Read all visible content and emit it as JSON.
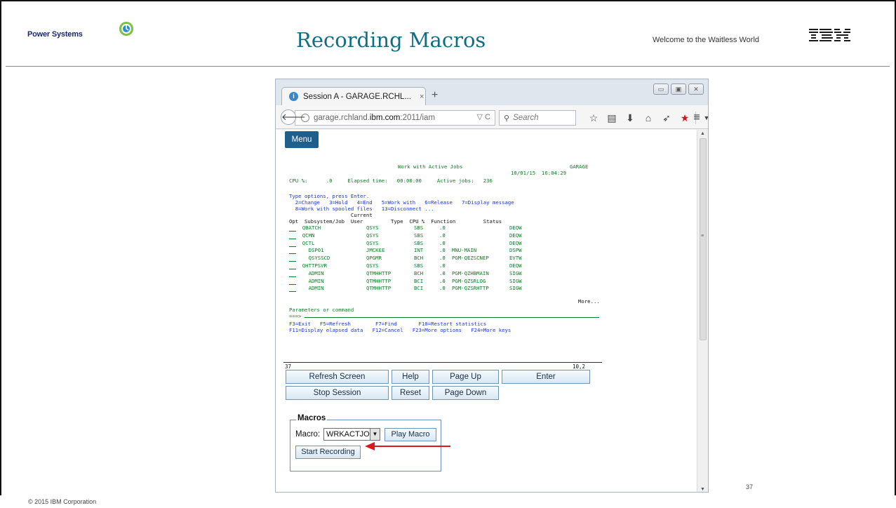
{
  "slide": {
    "title": "Recording Macros",
    "brand_left": "Power Systems",
    "welcome": "Welcome to the Waitless World",
    "brand_right": "IBM",
    "copyright": "© 2015 IBM Corporation",
    "page_number": "37"
  },
  "browser": {
    "tab_title": "Session A - GARAGE.RCHL...",
    "tab_close": "×",
    "new_tab": "+",
    "url_prefix": "garage.rchland.",
    "url_domain": "ibm.com",
    "url_suffix": ":2011/iam",
    "url_tail": "▽ C",
    "search_placeholder": "Search",
    "icons": [
      "back-icon",
      "globe-icon",
      "star-icon",
      "reading-list-icon",
      "download-icon",
      "home-icon",
      "send-icon",
      "bookmark-star-icon",
      "dropdown-icon",
      "hamburger-menu-icon"
    ],
    "win_buttons": [
      "minimize",
      "maximize",
      "close"
    ]
  },
  "terminal": {
    "menu_button": "Menu",
    "screen_title": "Work with Active Jobs",
    "system_name": "GARAGE",
    "date_time": "10/01/15  16:04:29",
    "stats_line": "CPU %:      .0     Elapsed time:   00:00:00     Active jobs:   236",
    "instr_line": "Type options, press Enter.",
    "options_line1": "  2=Change   3=Hold   4=End   5=Work with   6=Release   7=Display message",
    "options_line2": "  8=Work with spooled files   13=Disconnect ...",
    "header_line1": "                    Current",
    "header_line2": "Opt  Subsystem/Job  User         Type  CPU %  Function         Status",
    "rows": [
      {
        "job": "  QBATCH",
        "user": "QSYS",
        "type": "SBS",
        "cpu": ".0",
        "function": "",
        "status": "DEQW"
      },
      {
        "job": "  QCMN",
        "user": "QSYS",
        "type": "SBS",
        "cpu": ".0",
        "function": "",
        "status": "DEQW"
      },
      {
        "job": "  QCTL",
        "user": "QSYS",
        "type": "SBS",
        "cpu": ".0",
        "function": "",
        "status": "DEQW"
      },
      {
        "job": "    DSP01",
        "user": "JMCKEE",
        "type": "INT",
        "cpu": ".0",
        "function": "MNU-MAIN",
        "status": "DSPW"
      },
      {
        "job": "    QSYSSCD",
        "user": "QPGMR",
        "type": "BCH",
        "cpu": ".0",
        "function": "PGM-QEZSCNEP",
        "status": "EVTW"
      },
      {
        "job": "  QHTTPSVR",
        "user": "QSYS",
        "type": "SBS",
        "cpu": ".0",
        "function": "",
        "status": "DEQW"
      },
      {
        "job": "    ADMIN",
        "user": "QTMHHTTP",
        "type": "BCH",
        "cpu": ".0",
        "function": "PGM-QZHBMAIN",
        "status": "SIGW"
      },
      {
        "job": "    ADMIN",
        "user": "QTMHHTTP",
        "type": "BCI",
        "cpu": ".0",
        "function": "PGM-QZSRLOG",
        "status": "SIGW"
      },
      {
        "job": "    ADMIN",
        "user": "QTMHHTTP",
        "type": "BCI",
        "cpu": ".0",
        "function": "PGM-QZSRHTTP",
        "status": "SIGW"
      }
    ],
    "more": "More...",
    "params_label": "Parameters or command",
    "prompt": "===>",
    "fkeys_line1": "F3=Exit   F5=Refresh        F7=Find       F10=Restart statistics",
    "fkeys_line2": "F11=Display elapsed data   F12=Cancel   F23=More options   F24=More keys",
    "status_left": "37",
    "status_right": "10,2"
  },
  "buttons": {
    "refresh": "Refresh Screen",
    "help": "Help",
    "page_up": "Page Up",
    "enter": "Enter",
    "stop": "Stop Session",
    "reset": "Reset",
    "page_down": "Page Down"
  },
  "macros": {
    "legend": "Macros",
    "macro_label": "Macro:",
    "selected_macro": "WRKACTJOB",
    "play_button": "Play Macro",
    "start_button": "Start Recording"
  },
  "colors": {
    "terminal_green": "#0b7f24",
    "terminal_blue": "#1737d6",
    "title_teal": "#0f6e84",
    "menu_blue": "#1f5f8e",
    "annotation_red": "#e0161e"
  }
}
